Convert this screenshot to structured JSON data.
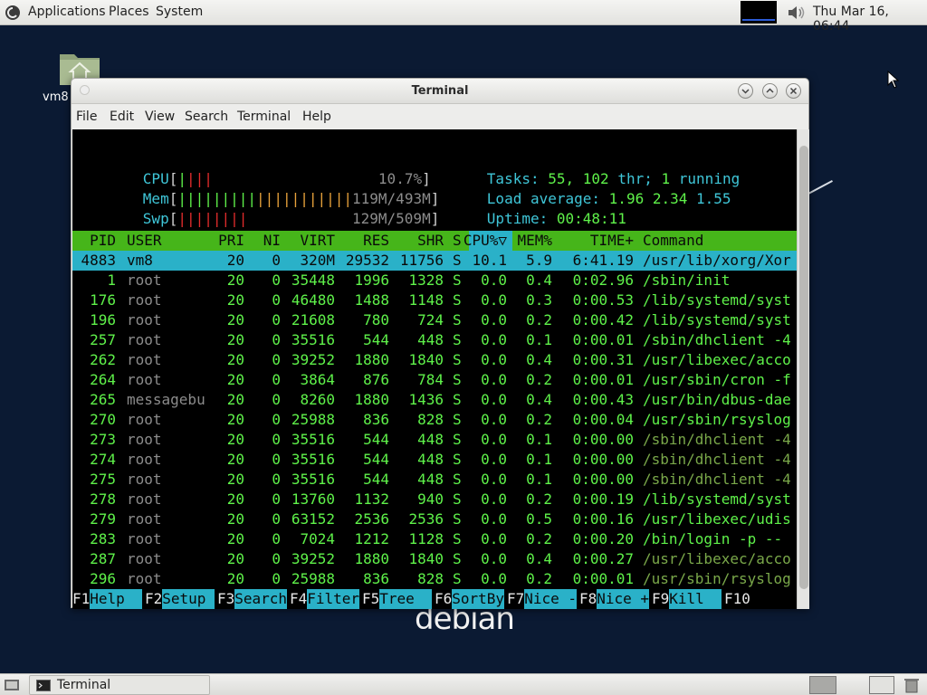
{
  "top_panel": {
    "menus": [
      "Applications",
      "Places",
      "System"
    ],
    "clock": "Thu Mar 16, 06:44"
  },
  "desktop": {
    "home_label": "vm8",
    "logo_text": "debian"
  },
  "window": {
    "title": "Terminal",
    "menubar": [
      "File",
      "Edit",
      "Search",
      "Terminal",
      "Help"
    ],
    "menubar_view": "View"
  },
  "htop": {
    "cpu_label": "CPU",
    "cpu_value": "10.7%",
    "mem_label": "Mem",
    "mem_value": "119M/493M",
    "swp_label": "Swp",
    "swp_value": "129M/509M",
    "tasks_label": "Tasks:",
    "tasks_count": "55,",
    "threads_count": "102",
    "threads_label": "thr;",
    "running_count": "1",
    "running_label": "running",
    "load_label": "Load average:",
    "load_1": "1.96",
    "load_5": "2.34",
    "load_15": "1.55",
    "uptime_label": "Uptime:",
    "uptime_value": "00:48:11",
    "columns": [
      "PID",
      "USER",
      "PRI",
      "NI",
      "VIRT",
      "RES",
      "SHR",
      "S",
      "CPU%▽",
      "MEM%",
      "TIME+",
      "Command"
    ],
    "rows": [
      {
        "pid": "4883",
        "user": "vm8",
        "pri": "20",
        "ni": "0",
        "virt": "320M",
        "res": "29532",
        "shr": "11756",
        "s": "S",
        "cpu": "10.1",
        "mem": "5.9",
        "time": "6:41.19",
        "cmd": "/usr/lib/xorg/Xor"
      },
      {
        "pid": "1",
        "user": "root",
        "pri": "20",
        "ni": "0",
        "virt": "35448",
        "res": "1996",
        "shr": "1328",
        "s": "S",
        "cpu": "0.0",
        "mem": "0.4",
        "time": "0:02.96",
        "cmd": "/sbin/init"
      },
      {
        "pid": "176",
        "user": "root",
        "pri": "20",
        "ni": "0",
        "virt": "46480",
        "res": "1488",
        "shr": "1148",
        "s": "S",
        "cpu": "0.0",
        "mem": "0.3",
        "time": "0:00.53",
        "cmd": "/lib/systemd/syst"
      },
      {
        "pid": "196",
        "user": "root",
        "pri": "20",
        "ni": "0",
        "virt": "21608",
        "res": "780",
        "shr": "724",
        "s": "S",
        "cpu": "0.0",
        "mem": "0.2",
        "time": "0:00.42",
        "cmd": "/lib/systemd/syst"
      },
      {
        "pid": "257",
        "user": "root",
        "pri": "20",
        "ni": "0",
        "virt": "35516",
        "res": "544",
        "shr": "448",
        "s": "S",
        "cpu": "0.0",
        "mem": "0.1",
        "time": "0:00.01",
        "cmd": "/sbin/dhclient -4"
      },
      {
        "pid": "262",
        "user": "root",
        "pri": "20",
        "ni": "0",
        "virt": "39252",
        "res": "1880",
        "shr": "1840",
        "s": "S",
        "cpu": "0.0",
        "mem": "0.4",
        "time": "0:00.31",
        "cmd": "/usr/libexec/acco"
      },
      {
        "pid": "264",
        "user": "root",
        "pri": "20",
        "ni": "0",
        "virt": "3864",
        "res": "876",
        "shr": "784",
        "s": "S",
        "cpu": "0.0",
        "mem": "0.2",
        "time": "0:00.01",
        "cmd": "/usr/sbin/cron -f"
      },
      {
        "pid": "265",
        "user": "messagebu",
        "pri": "20",
        "ni": "0",
        "virt": "8260",
        "res": "1880",
        "shr": "1436",
        "s": "S",
        "cpu": "0.0",
        "mem": "0.4",
        "time": "0:00.43",
        "cmd": "/usr/bin/dbus-dae"
      },
      {
        "pid": "270",
        "user": "root",
        "pri": "20",
        "ni": "0",
        "virt": "25988",
        "res": "836",
        "shr": "828",
        "s": "S",
        "cpu": "0.0",
        "mem": "0.2",
        "time": "0:00.04",
        "cmd": "/usr/sbin/rsyslog"
      },
      {
        "pid": "273",
        "user": "root",
        "pri": "20",
        "ni": "0",
        "virt": "35516",
        "res": "544",
        "shr": "448",
        "s": "S",
        "cpu": "0.0",
        "mem": "0.1",
        "time": "0:00.00",
        "cmd": "/sbin/dhclient -4"
      },
      {
        "pid": "274",
        "user": "root",
        "pri": "20",
        "ni": "0",
        "virt": "35516",
        "res": "544",
        "shr": "448",
        "s": "S",
        "cpu": "0.0",
        "mem": "0.1",
        "time": "0:00.00",
        "cmd": "/sbin/dhclient -4"
      },
      {
        "pid": "275",
        "user": "root",
        "pri": "20",
        "ni": "0",
        "virt": "35516",
        "res": "544",
        "shr": "448",
        "s": "S",
        "cpu": "0.0",
        "mem": "0.1",
        "time": "0:00.00",
        "cmd": "/sbin/dhclient -4"
      },
      {
        "pid": "278",
        "user": "root",
        "pri": "20",
        "ni": "0",
        "virt": "13760",
        "res": "1132",
        "shr": "940",
        "s": "S",
        "cpu": "0.0",
        "mem": "0.2",
        "time": "0:00.19",
        "cmd": "/lib/systemd/syst"
      },
      {
        "pid": "279",
        "user": "root",
        "pri": "20",
        "ni": "0",
        "virt": "63152",
        "res": "2536",
        "shr": "2536",
        "s": "S",
        "cpu": "0.0",
        "mem": "0.5",
        "time": "0:00.16",
        "cmd": "/usr/libexec/udis"
      },
      {
        "pid": "283",
        "user": "root",
        "pri": "20",
        "ni": "0",
        "virt": "7024",
        "res": "1212",
        "shr": "1128",
        "s": "S",
        "cpu": "0.0",
        "mem": "0.2",
        "time": "0:00.20",
        "cmd": "/bin/login -p --"
      },
      {
        "pid": "287",
        "user": "root",
        "pri": "20",
        "ni": "0",
        "virt": "39252",
        "res": "1880",
        "shr": "1840",
        "s": "S",
        "cpu": "0.0",
        "mem": "0.4",
        "time": "0:00.27",
        "cmd": "/usr/libexec/acco"
      },
      {
        "pid": "296",
        "user": "root",
        "pri": "20",
        "ni": "0",
        "virt": "25988",
        "res": "836",
        "shr": "828",
        "s": "S",
        "cpu": "0.0",
        "mem": "0.2",
        "time": "0:00.01",
        "cmd": "/usr/sbin/rsyslog"
      }
    ],
    "fkeys": [
      {
        "key": "F1",
        "label": "Help  "
      },
      {
        "key": "F2",
        "label": "Setup "
      },
      {
        "key": "F3",
        "label": "Search"
      },
      {
        "key": "F4",
        "label": "Filter"
      },
      {
        "key": "F5",
        "label": "Tree  "
      },
      {
        "key": "F6",
        "label": "SortBy"
      },
      {
        "key": "F7",
        "label": "Nice -"
      },
      {
        "key": "F8",
        "label": "Nice +"
      },
      {
        "key": "F9",
        "label": "Kill  "
      },
      {
        "key": "F10",
        "label": "Quit  "
      }
    ]
  },
  "bottom_panel": {
    "task_label": "Terminal"
  },
  "colors": {
    "header_bg": "#46b51a",
    "selection_bg": "#2ab1c8",
    "desktop_bg": "#0b1a33"
  }
}
